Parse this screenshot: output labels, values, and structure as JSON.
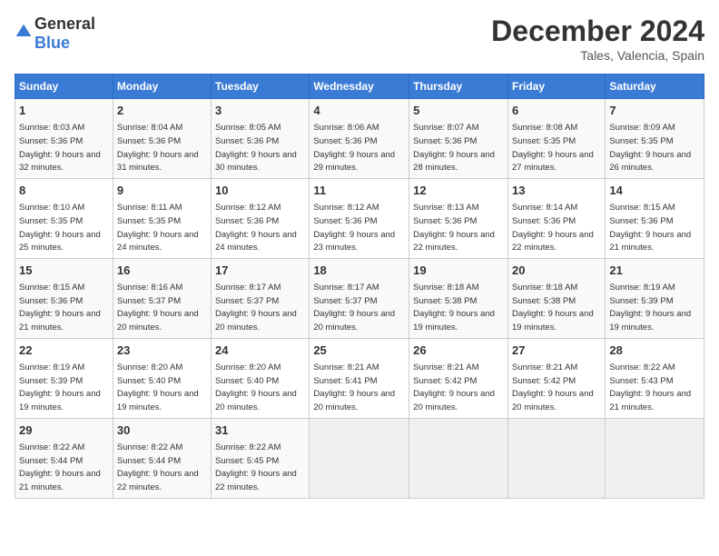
{
  "header": {
    "logo_general": "General",
    "logo_blue": "Blue",
    "month_title": "December 2024",
    "location": "Tales, Valencia, Spain"
  },
  "weekdays": [
    "Sunday",
    "Monday",
    "Tuesday",
    "Wednesday",
    "Thursday",
    "Friday",
    "Saturday"
  ],
  "weeks": [
    [
      {
        "day": "1",
        "sunrise": "8:03 AM",
        "sunset": "5:36 PM",
        "daylight": "9 hours and 32 minutes."
      },
      {
        "day": "2",
        "sunrise": "8:04 AM",
        "sunset": "5:36 PM",
        "daylight": "9 hours and 31 minutes."
      },
      {
        "day": "3",
        "sunrise": "8:05 AM",
        "sunset": "5:36 PM",
        "daylight": "9 hours and 30 minutes."
      },
      {
        "day": "4",
        "sunrise": "8:06 AM",
        "sunset": "5:36 PM",
        "daylight": "9 hours and 29 minutes."
      },
      {
        "day": "5",
        "sunrise": "8:07 AM",
        "sunset": "5:36 PM",
        "daylight": "9 hours and 28 minutes."
      },
      {
        "day": "6",
        "sunrise": "8:08 AM",
        "sunset": "5:35 PM",
        "daylight": "9 hours and 27 minutes."
      },
      {
        "day": "7",
        "sunrise": "8:09 AM",
        "sunset": "5:35 PM",
        "daylight": "9 hours and 26 minutes."
      }
    ],
    [
      {
        "day": "8",
        "sunrise": "8:10 AM",
        "sunset": "5:35 PM",
        "daylight": "9 hours and 25 minutes."
      },
      {
        "day": "9",
        "sunrise": "8:11 AM",
        "sunset": "5:35 PM",
        "daylight": "9 hours and 24 minutes."
      },
      {
        "day": "10",
        "sunrise": "8:12 AM",
        "sunset": "5:36 PM",
        "daylight": "9 hours and 24 minutes."
      },
      {
        "day": "11",
        "sunrise": "8:12 AM",
        "sunset": "5:36 PM",
        "daylight": "9 hours and 23 minutes."
      },
      {
        "day": "12",
        "sunrise": "8:13 AM",
        "sunset": "5:36 PM",
        "daylight": "9 hours and 22 minutes."
      },
      {
        "day": "13",
        "sunrise": "8:14 AM",
        "sunset": "5:36 PM",
        "daylight": "9 hours and 22 minutes."
      },
      {
        "day": "14",
        "sunrise": "8:15 AM",
        "sunset": "5:36 PM",
        "daylight": "9 hours and 21 minutes."
      }
    ],
    [
      {
        "day": "15",
        "sunrise": "8:15 AM",
        "sunset": "5:36 PM",
        "daylight": "9 hours and 21 minutes."
      },
      {
        "day": "16",
        "sunrise": "8:16 AM",
        "sunset": "5:37 PM",
        "daylight": "9 hours and 20 minutes."
      },
      {
        "day": "17",
        "sunrise": "8:17 AM",
        "sunset": "5:37 PM",
        "daylight": "9 hours and 20 minutes."
      },
      {
        "day": "18",
        "sunrise": "8:17 AM",
        "sunset": "5:37 PM",
        "daylight": "9 hours and 20 minutes."
      },
      {
        "day": "19",
        "sunrise": "8:18 AM",
        "sunset": "5:38 PM",
        "daylight": "9 hours and 19 minutes."
      },
      {
        "day": "20",
        "sunrise": "8:18 AM",
        "sunset": "5:38 PM",
        "daylight": "9 hours and 19 minutes."
      },
      {
        "day": "21",
        "sunrise": "8:19 AM",
        "sunset": "5:39 PM",
        "daylight": "9 hours and 19 minutes."
      }
    ],
    [
      {
        "day": "22",
        "sunrise": "8:19 AM",
        "sunset": "5:39 PM",
        "daylight": "9 hours and 19 minutes."
      },
      {
        "day": "23",
        "sunrise": "8:20 AM",
        "sunset": "5:40 PM",
        "daylight": "9 hours and 19 minutes."
      },
      {
        "day": "24",
        "sunrise": "8:20 AM",
        "sunset": "5:40 PM",
        "daylight": "9 hours and 20 minutes."
      },
      {
        "day": "25",
        "sunrise": "8:21 AM",
        "sunset": "5:41 PM",
        "daylight": "9 hours and 20 minutes."
      },
      {
        "day": "26",
        "sunrise": "8:21 AM",
        "sunset": "5:42 PM",
        "daylight": "9 hours and 20 minutes."
      },
      {
        "day": "27",
        "sunrise": "8:21 AM",
        "sunset": "5:42 PM",
        "daylight": "9 hours and 20 minutes."
      },
      {
        "day": "28",
        "sunrise": "8:22 AM",
        "sunset": "5:43 PM",
        "daylight": "9 hours and 21 minutes."
      }
    ],
    [
      {
        "day": "29",
        "sunrise": "8:22 AM",
        "sunset": "5:44 PM",
        "daylight": "9 hours and 21 minutes."
      },
      {
        "day": "30",
        "sunrise": "8:22 AM",
        "sunset": "5:44 PM",
        "daylight": "9 hours and 22 minutes."
      },
      {
        "day": "31",
        "sunrise": "8:22 AM",
        "sunset": "5:45 PM",
        "daylight": "9 hours and 22 minutes."
      },
      null,
      null,
      null,
      null
    ]
  ]
}
